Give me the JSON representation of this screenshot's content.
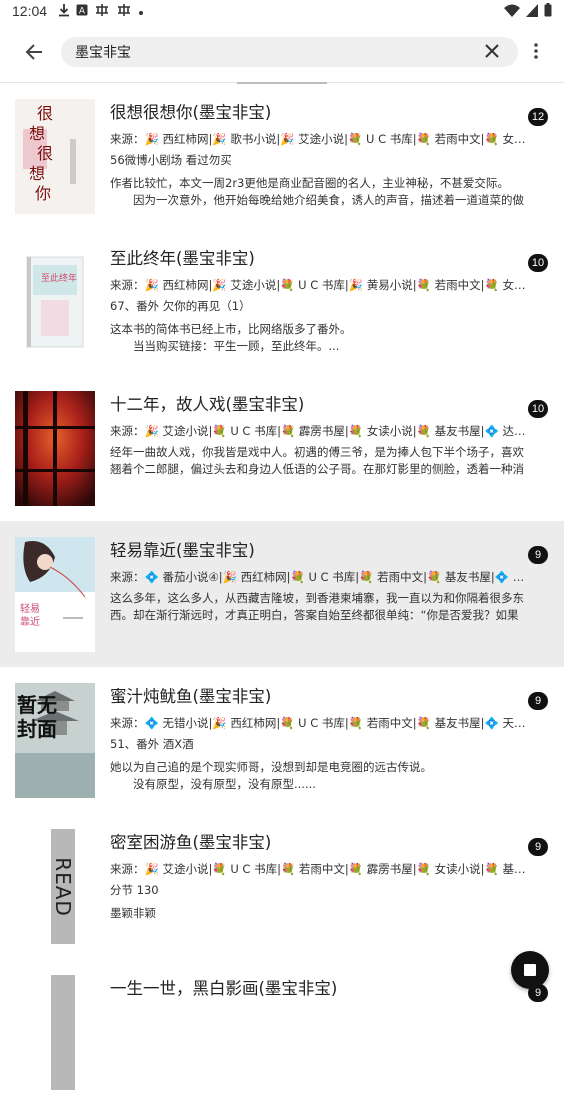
{
  "status_bar": {
    "time": "12:04",
    "icons": [
      "download-icon",
      "a-icon",
      "app-icon",
      "app-icon",
      "dot-icon"
    ],
    "right_icons": [
      "wifi-icon",
      "signal-icon",
      "battery-icon"
    ]
  },
  "toolbar": {
    "back_icon": "arrow-left-icon",
    "search_value": "墨宝非宝",
    "clear_icon": "close-icon",
    "more_icon": "more-vert-icon"
  },
  "books": [
    {
      "title": "很想很想你(墨宝非宝)",
      "count": "12",
      "sources": "来源：🎉 西红柿网|🎉 歌书小说|🎉 艾途小说|💐 U C 书库|💐 若雨中文|💐 女读小说",
      "latest": "56微博小剧场 看过勿买",
      "intro": "作者比较忙，本文一周2r3更他是商业配音圈的名人，主业神秘，不甚爱交际。\n　　因为一次意外，他开始每晚给她介绍美食，诱人的声音，描述着一道道菜的做法",
      "cover_style": "c1",
      "highlight": false
    },
    {
      "title": "至此终年(墨宝非宝)",
      "count": "10",
      "sources": "来源：🎉 西红柿网|🎉 艾途小说|💐 U C 书库|🎉 黄易小说|💐 若雨中文|💐 女读小说",
      "latest": "67、番外 欠你的再见（1）",
      "intro": "这本书的简体书已经上市，比网络版多了番外。\n　　当当购买链接：平生一顾，至此终年。...",
      "cover_style": "c2",
      "highlight": false
    },
    {
      "title": "十二年，故人戏(墨宝非宝)",
      "count": "10",
      "sources": "来源：🎉 艾途小说|💐 U C 书库|💐 霹雳书屋|💐 女读小说|💐 基友书屋|💠 达文小说",
      "latest": "",
      "intro": "经年一曲故人戏，你我皆是戏中人。初遇的傅三爷，是为捧人包下半个场子，喜欢翘着个二郎腿，偏过头去和身边人低语的公子哥。在那灯影里的侧脸，透着一种消沉的味道",
      "cover_style": "c3",
      "highlight": false
    },
    {
      "title": "轻易靠近(墨宝非宝)",
      "count": "9",
      "sources": "来源：💠 番茄小说④|🎉 西红柿网|💐 U C 书库|💐 若雨中文|💐 基友书屋|💠 亿软小说",
      "latest": "",
      "intro": "这么多年，这么多人，从西藏吉隆坡，到香港柬埔寨，我一直以为和你隔着很多东西。却在渐行渐远时，才真正明白，答案自始至终都很单纯：“你是否爱我？如果爱，",
      "cover_style": "c4",
      "highlight": true
    },
    {
      "title": "蜜汁炖鱿鱼(墨宝非宝)",
      "count": "9",
      "sources": "来源：💠 无错小说|🎉 西红柿网|💐 U C 书库|💐 若雨中文|💐 基友书屋|💠 天天看书",
      "latest": "51、番外 酒X酒",
      "intro": "她以为自己追的是个现实师哥，没想到却是电竞圈的远古传说。\n　　没有原型，没有原型，没有原型......",
      "cover_style": "c5",
      "highlight": false
    },
    {
      "title": "密室困游鱼(墨宝非宝)",
      "count": "9",
      "sources": "来源：🎉 艾途小说|💐 U C 书库|💐 若雨中文|💐 霹雳书屋|💐 女读小说|💐 基友书屋",
      "latest": "分节 130",
      "intro": "墨颖非颖",
      "cover_style": "c6",
      "highlight": false
    },
    {
      "title": "一生一世，黑白影画(墨宝非宝)",
      "count": "9",
      "sources": "",
      "latest": "",
      "intro": "",
      "cover_style": "c6",
      "highlight": false
    }
  ],
  "covers": {
    "c1_text": "很想很想你",
    "c5_text": "暂无封面",
    "c6_text": "READ"
  },
  "fab": {
    "icon": "stop-icon"
  }
}
